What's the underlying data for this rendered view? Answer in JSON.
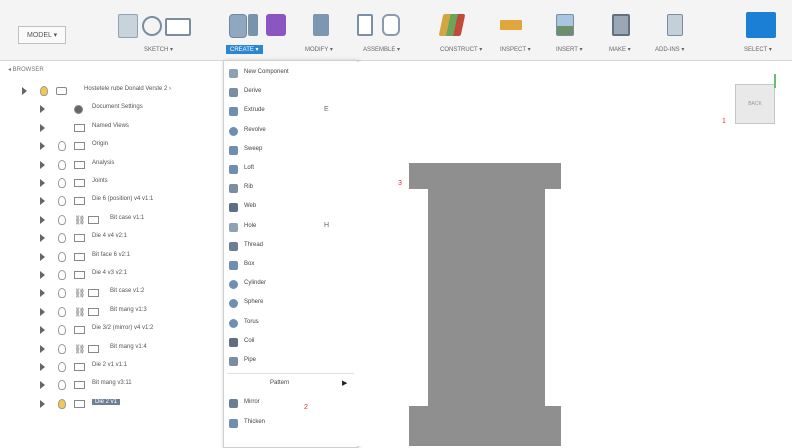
{
  "toolbar": {
    "workspace": "MODEL ▾",
    "tabs": [
      "SKETCH ▾",
      "CREATE ▾",
      "MODIFY ▾",
      "ASSEMBLE ▾",
      "CONSTRUCT ▾",
      "INSPECT ▾",
      "INSERT ▾",
      "MAKE ▾",
      "ADD-INS ▾",
      "SELECT ▾"
    ],
    "colors": {
      "create_active": "#2c87d3",
      "create_purple": "#8b55c2",
      "select_blue": "#1c7fd6"
    }
  },
  "browser": {
    "header": "◂ BROWSER",
    "items": [
      {
        "label": "Hostetele rube Donald Verste 2 ›",
        "icon": "component",
        "depth": 0
      },
      {
        "label": "Document Settings",
        "icon": "gear",
        "depth": 1
      },
      {
        "label": "Named Views",
        "icon": "folder",
        "depth": 1
      },
      {
        "label": "Origin",
        "icon": "folder",
        "depth": 1
      },
      {
        "label": "Analysis",
        "icon": "folder",
        "depth": 1
      },
      {
        "label": "Joints",
        "icon": "folder",
        "depth": 1
      },
      {
        "label": "Die 6 (position) v4 v1:1",
        "icon": "body",
        "depth": 1
      },
      {
        "label": "Bit case v1:1",
        "icon": "link",
        "depth": 1
      },
      {
        "label": "Die 4 v4 v2:1",
        "icon": "body",
        "depth": 1
      },
      {
        "label": "Bit face 6 v2:1",
        "icon": "body",
        "depth": 1
      },
      {
        "label": "Die 4 v3 v2:1",
        "icon": "body",
        "depth": 1
      },
      {
        "label": "Bit case v1:2",
        "icon": "link",
        "depth": 1
      },
      {
        "label": "Bit mang v1:3",
        "icon": "link",
        "depth": 1
      },
      {
        "label": "Die 3/2 (mirror) v4 v1:2",
        "icon": "body",
        "depth": 1
      },
      {
        "label": "Bit mang v1:4",
        "icon": "link",
        "depth": 1
      },
      {
        "label": "Die 2 v1 v1:1",
        "icon": "body",
        "depth": 1
      },
      {
        "label": "Bit mang v3:11",
        "icon": "body",
        "depth": 1
      },
      {
        "label": "Die 2 v1",
        "icon": "body",
        "depth": 1
      }
    ]
  },
  "create_menu": {
    "items": [
      {
        "label": "New Component",
        "icon": "component",
        "extra": ""
      },
      {
        "label": "Derive",
        "icon": "derive",
        "extra": ""
      },
      {
        "label": "Extrude",
        "icon": "extrude",
        "extra": "E"
      },
      {
        "label": "Revolve",
        "icon": "revolve",
        "extra": ""
      },
      {
        "label": "Sweep",
        "icon": "sweep",
        "extra": ""
      },
      {
        "label": "Loft",
        "icon": "loft",
        "extra": ""
      },
      {
        "label": "Rib",
        "icon": "rib",
        "extra": ""
      },
      {
        "label": "Web",
        "icon": "web",
        "extra": ""
      },
      {
        "label": "Hole",
        "icon": "hole",
        "extra": "H"
      },
      {
        "label": "Thread",
        "icon": "thread",
        "extra": ""
      },
      {
        "label": "Box",
        "icon": "box",
        "extra": ""
      },
      {
        "label": "Cylinder",
        "icon": "cylinder",
        "extra": ""
      },
      {
        "label": "Sphere",
        "icon": "sphere",
        "extra": ""
      },
      {
        "label": "Torus",
        "icon": "torus",
        "extra": ""
      },
      {
        "label": "Coil",
        "icon": "coil",
        "extra": ""
      },
      {
        "label": "Pipe",
        "icon": "pipe",
        "extra": ""
      },
      {
        "label": "Pattern",
        "icon": "",
        "extra": "▶"
      },
      {
        "label": "Mirror",
        "icon": "mirror",
        "extra": ""
      },
      {
        "label": "Thicken",
        "icon": "thicken",
        "extra": ""
      }
    ]
  },
  "viewcube": {
    "label": "BACK"
  },
  "markers": [
    "1",
    "2",
    "3"
  ]
}
